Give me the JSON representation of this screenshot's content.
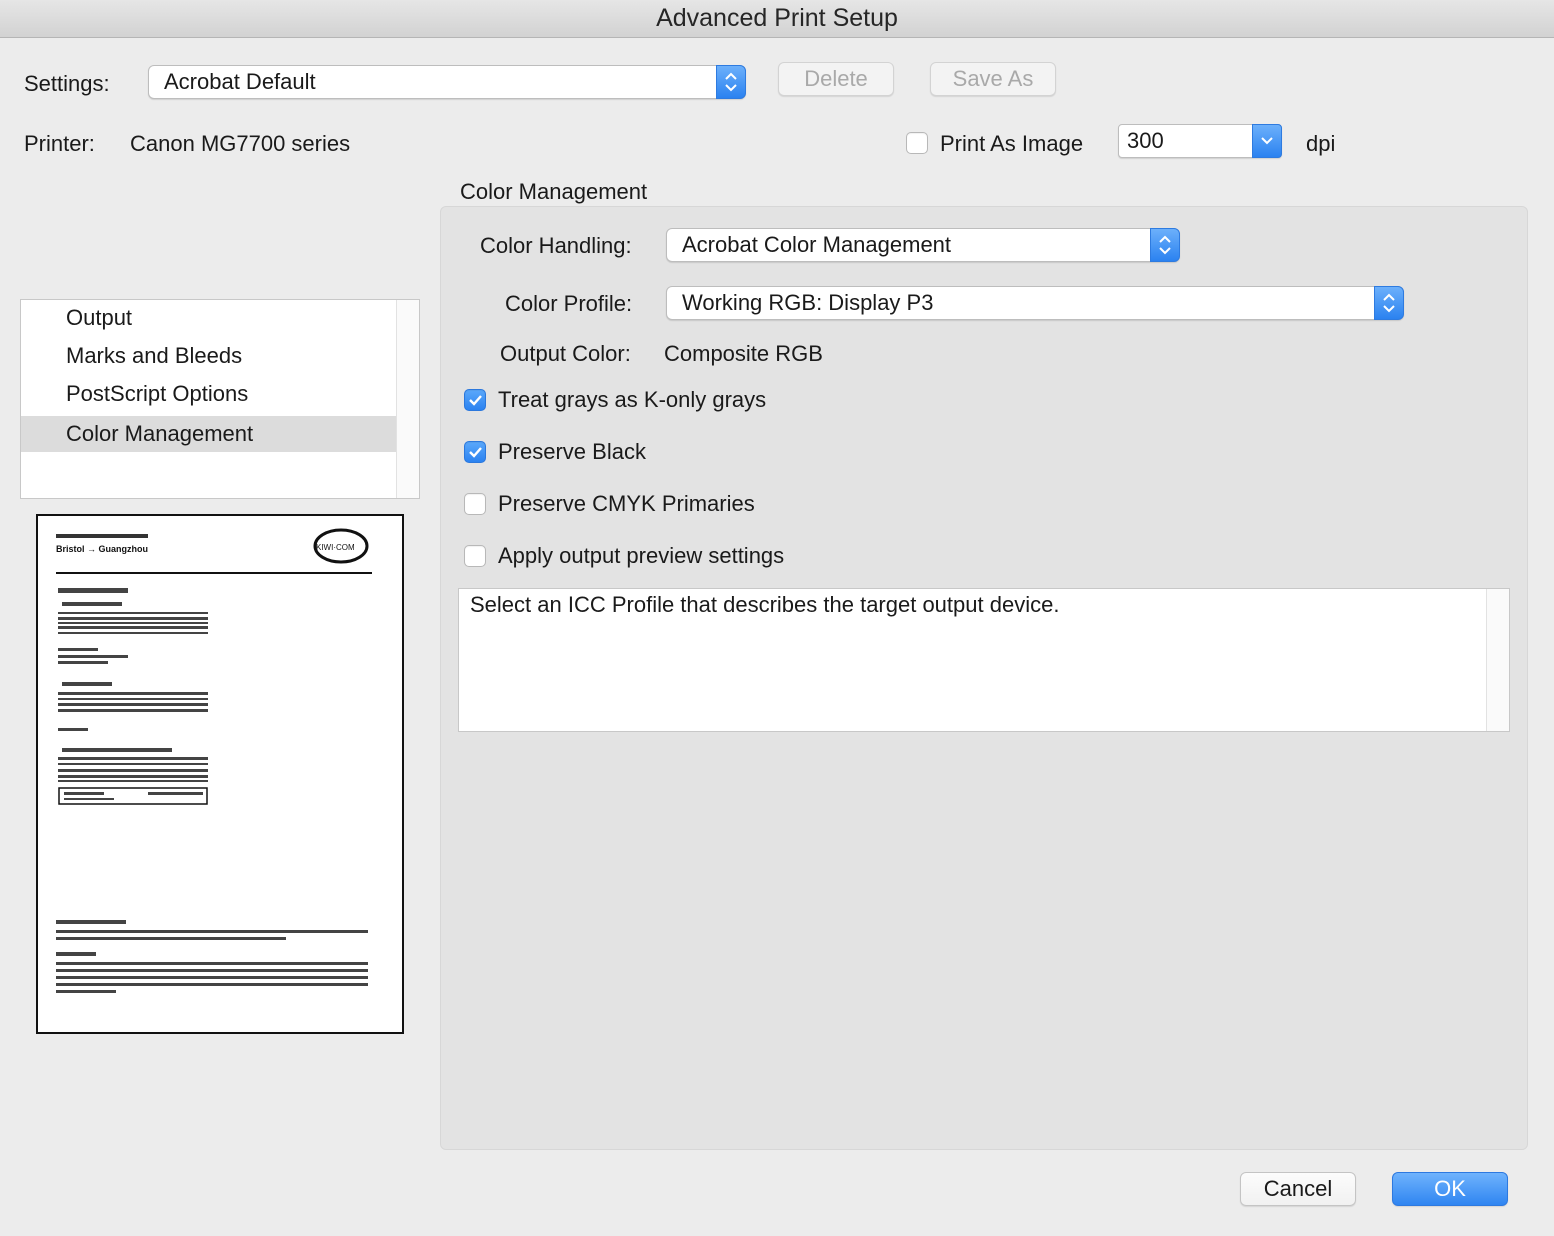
{
  "window": {
    "title": "Advanced Print Setup"
  },
  "settings": {
    "label": "Settings:",
    "value": "Acrobat Default",
    "delete_label": "Delete",
    "save_as_label": "Save As"
  },
  "printer": {
    "label": "Printer:",
    "value": "Canon MG7700 series"
  },
  "print_as_image": {
    "label": "Print As Image",
    "checked": false,
    "dpi_value": "300",
    "dpi_unit": "dpi"
  },
  "sidebar": {
    "items": [
      {
        "label": "Output",
        "selected": false
      },
      {
        "label": "Marks and Bleeds",
        "selected": false
      },
      {
        "label": "PostScript Options",
        "selected": false
      },
      {
        "label": "Color Management",
        "selected": true
      }
    ]
  },
  "preview": {
    "logo_text": "KIWI·COM",
    "route_text": "Bristol → Guangzhou"
  },
  "color_management": {
    "section_title": "Color Management",
    "color_handling": {
      "label": "Color Handling:",
      "value": "Acrobat Color Management"
    },
    "color_profile": {
      "label": "Color Profile:",
      "value": "Working RGB: Display P3"
    },
    "output_color": {
      "label": "Output Color:",
      "value": "Composite RGB"
    },
    "options": [
      {
        "label": "Treat grays as K-only grays",
        "checked": true
      },
      {
        "label": "Preserve Black",
        "checked": true
      },
      {
        "label": "Preserve CMYK Primaries",
        "checked": false
      },
      {
        "label": "Apply output preview settings",
        "checked": false
      }
    ],
    "description": "Select an ICC Profile that describes the target output device."
  },
  "footer": {
    "cancel_label": "Cancel",
    "ok_label": "OK"
  },
  "colors": {
    "accent": "#2f85f1",
    "window_bg": "#ececec",
    "panel_bg": "#e3e3e3"
  }
}
